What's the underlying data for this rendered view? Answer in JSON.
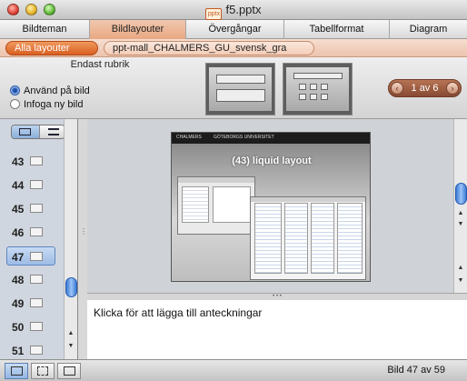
{
  "window": {
    "title": "f5.pptx",
    "doc_badge": "pptx"
  },
  "tabs": [
    {
      "label": "Bildteman"
    },
    {
      "label": "Bildlayouter"
    },
    {
      "label": "Övergångar"
    },
    {
      "label": "Tabellformat"
    },
    {
      "label": "Diagram"
    }
  ],
  "layout_filter": {
    "all_label": "Alla layouter",
    "template_label": "ppt-mall_CHALMERS_GU_svensk_gra"
  },
  "ribbon": {
    "group_label": "Endast rubrik",
    "options": [
      {
        "label": "Använd på bild",
        "selected": true
      },
      {
        "label": "Infoga ny bild",
        "selected": false
      }
    ],
    "pager": "1 av 6",
    "prev_icon": "‹",
    "next_icon": "›"
  },
  "slide_list": {
    "items": [
      {
        "number": "43"
      },
      {
        "number": "44"
      },
      {
        "number": "45"
      },
      {
        "number": "46"
      },
      {
        "number": "47",
        "selected": true
      },
      {
        "number": "48"
      },
      {
        "number": "49"
      },
      {
        "number": "50"
      },
      {
        "number": "51"
      }
    ]
  },
  "slide": {
    "header_left": "CHALMERS",
    "header_right": "GÖTEBORGS UNIVERSITET",
    "title": "(43) liquid layout"
  },
  "notes": {
    "placeholder": "Klicka för att lägga till anteckningar"
  },
  "status": {
    "slide_counter": "Bild 47 av 59"
  },
  "colors": {
    "accent": "#d95f22",
    "selection": "#3b7ad4"
  }
}
